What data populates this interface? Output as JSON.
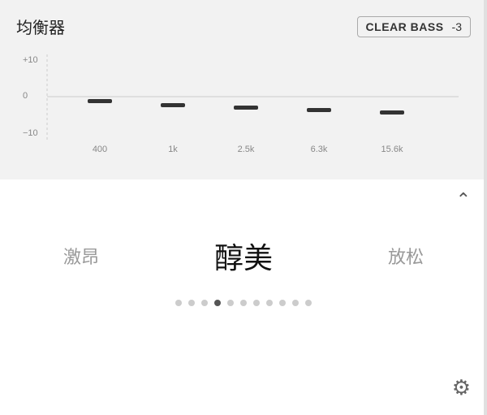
{
  "header": {
    "title": "均衡器",
    "preset": {
      "name": "CLEAR BASS",
      "value": "-3"
    }
  },
  "eq": {
    "bands": [
      {
        "label": "400",
        "value": -1
      },
      {
        "label": "1k",
        "value": -2
      },
      {
        "label": "2.5k",
        "value": -2.5
      },
      {
        "label": "6.3k",
        "value": -3
      },
      {
        "label": "15.6k",
        "value": -3.5
      }
    ],
    "y_labels": [
      "+10",
      "0",
      "-10"
    ],
    "y_min": -10,
    "y_max": 10
  },
  "sound_modes": [
    {
      "label": "激昂",
      "state": "inactive"
    },
    {
      "label": "醇美",
      "state": "active"
    },
    {
      "label": "放松",
      "state": "inactive"
    }
  ],
  "dots": {
    "count": 11,
    "active_index": 3
  },
  "chevron_up": "^",
  "settings_icon": "⚙"
}
